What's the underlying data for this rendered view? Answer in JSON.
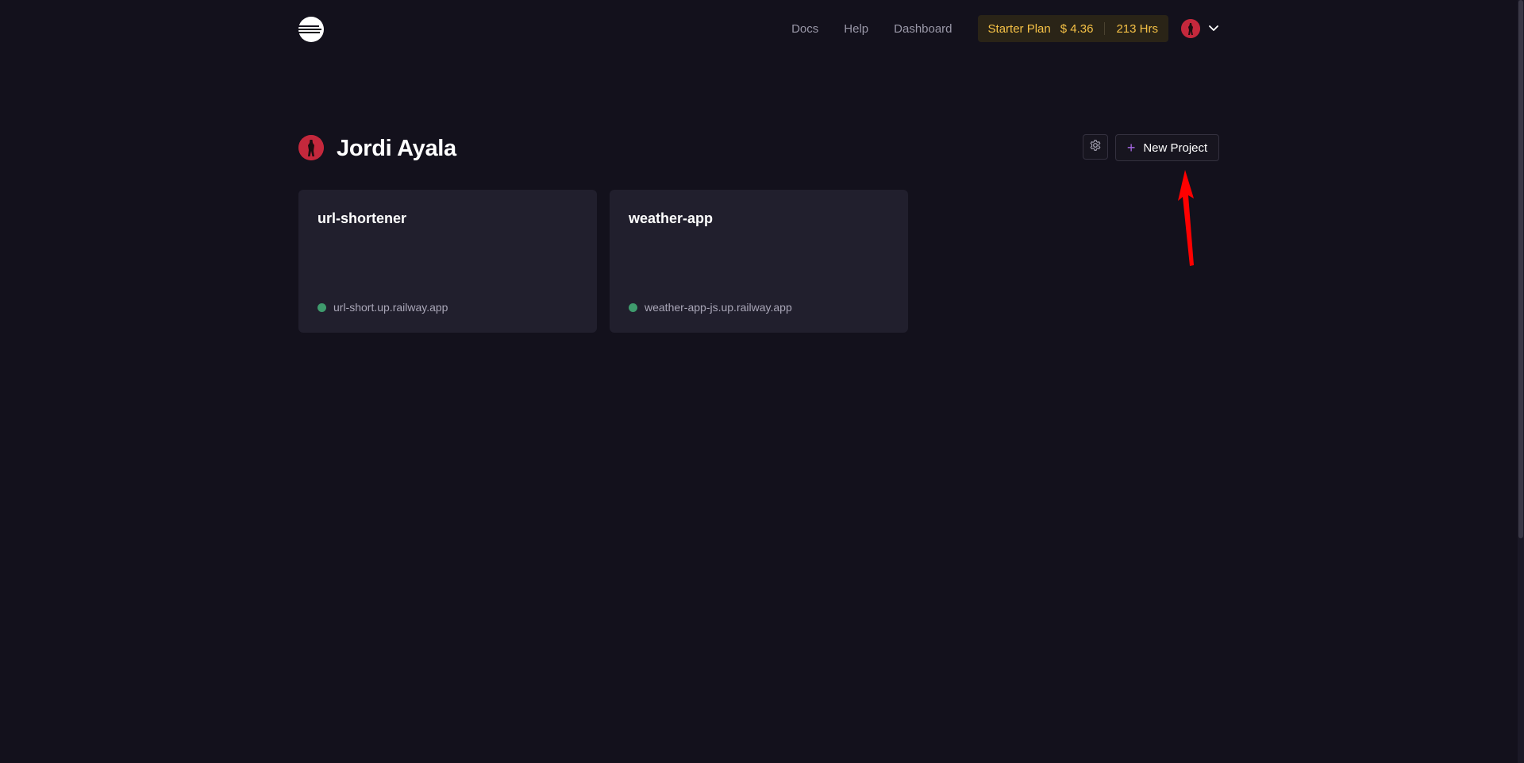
{
  "nav": {
    "links": [
      "Docs",
      "Help",
      "Dashboard"
    ],
    "plan": {
      "name": "Starter Plan",
      "price": "$ 4.36",
      "hours": "213 Hrs"
    }
  },
  "header": {
    "owner_name": "Jordi Ayala",
    "new_project_label": "New Project"
  },
  "projects": [
    {
      "name": "url-shortener",
      "domain": "url-short.up.railway.app",
      "status_color": "#3f9b6d"
    },
    {
      "name": "weather-app",
      "domain": "weather-app-js.up.railway.app",
      "status_color": "#3f9b6d"
    }
  ],
  "colors": {
    "background": "#13111c",
    "card": "#211f2d",
    "plan_accent": "#f5c146",
    "avatar": "#c4283c",
    "plus_accent": "#a667e4",
    "annotation": "#ff0000"
  },
  "icons": {
    "logo": "railway-logo-icon",
    "settings": "gear-icon",
    "menu": "chevron-down-icon",
    "add": "plus-icon"
  }
}
